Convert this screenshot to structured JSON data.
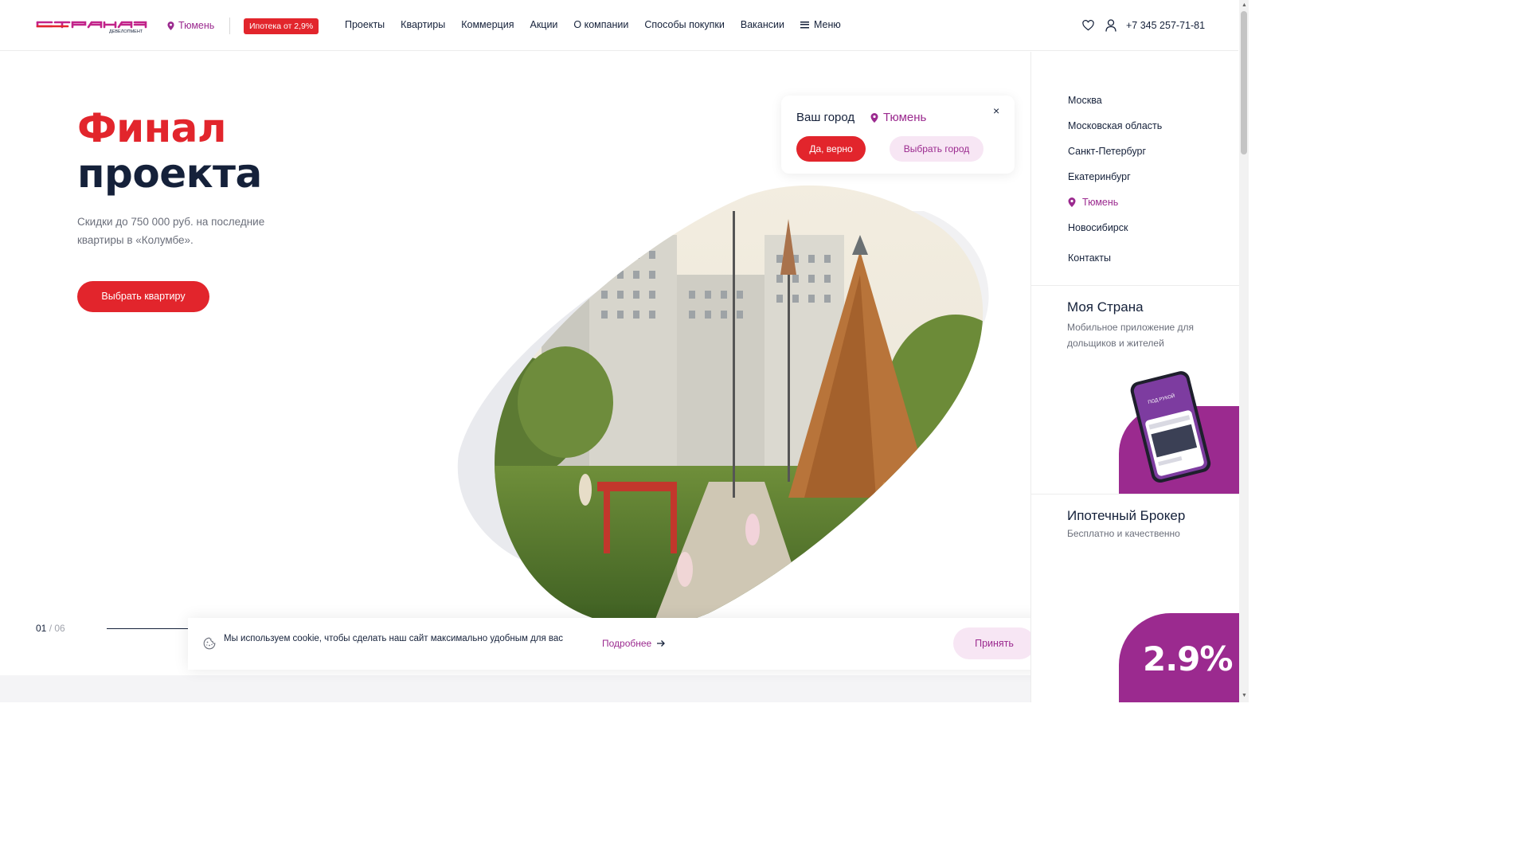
{
  "header": {
    "city": "Тюмень",
    "promo": "Ипотека от 2,9%",
    "nav": [
      "Проекты",
      "Квартиры",
      "Коммерция",
      "Акции",
      "О компании",
      "Способы покупки",
      "Вакансии"
    ],
    "menu": "Меню",
    "phone": "+7 345 257-71-81"
  },
  "hero": {
    "title_line1": "Финал",
    "title_line2": "проекта",
    "subtitle": "Скидки до 750 000 руб. на последние квартиры в «Колумбе».",
    "cta": "Выбрать квартиру"
  },
  "city_popup": {
    "label": "Ваш город",
    "city": "Тюмень",
    "close": "×",
    "yes": "Да, верно",
    "choose": "Выбрать город"
  },
  "sidebar": {
    "cities": [
      "Москва",
      "Московская область",
      "Санкт-Петербург",
      "Екатеринбург",
      "Тюмень",
      "Новосибирск"
    ],
    "active_city": "Тюмень",
    "contacts": "Контакты",
    "app_title": "Моя Страна",
    "app_subtitle": "Мобильное приложение для дольщиков и жителей",
    "broker_title": "Ипотечный Брокер",
    "broker_subtitle": "Бесплатно и качественно",
    "rate": "2.9%"
  },
  "slider": {
    "current": "01",
    "separator": " / ",
    "total": "06"
  },
  "cookie": {
    "text": "Мы используем cookie, чтобы сделать наш сайт максимально удобным для вас",
    "more": "Подробнее",
    "accept": "Принять"
  },
  "colors": {
    "brand_red": "#e2252c",
    "brand_purple": "#9b2a8f",
    "dark": "#15213a"
  }
}
